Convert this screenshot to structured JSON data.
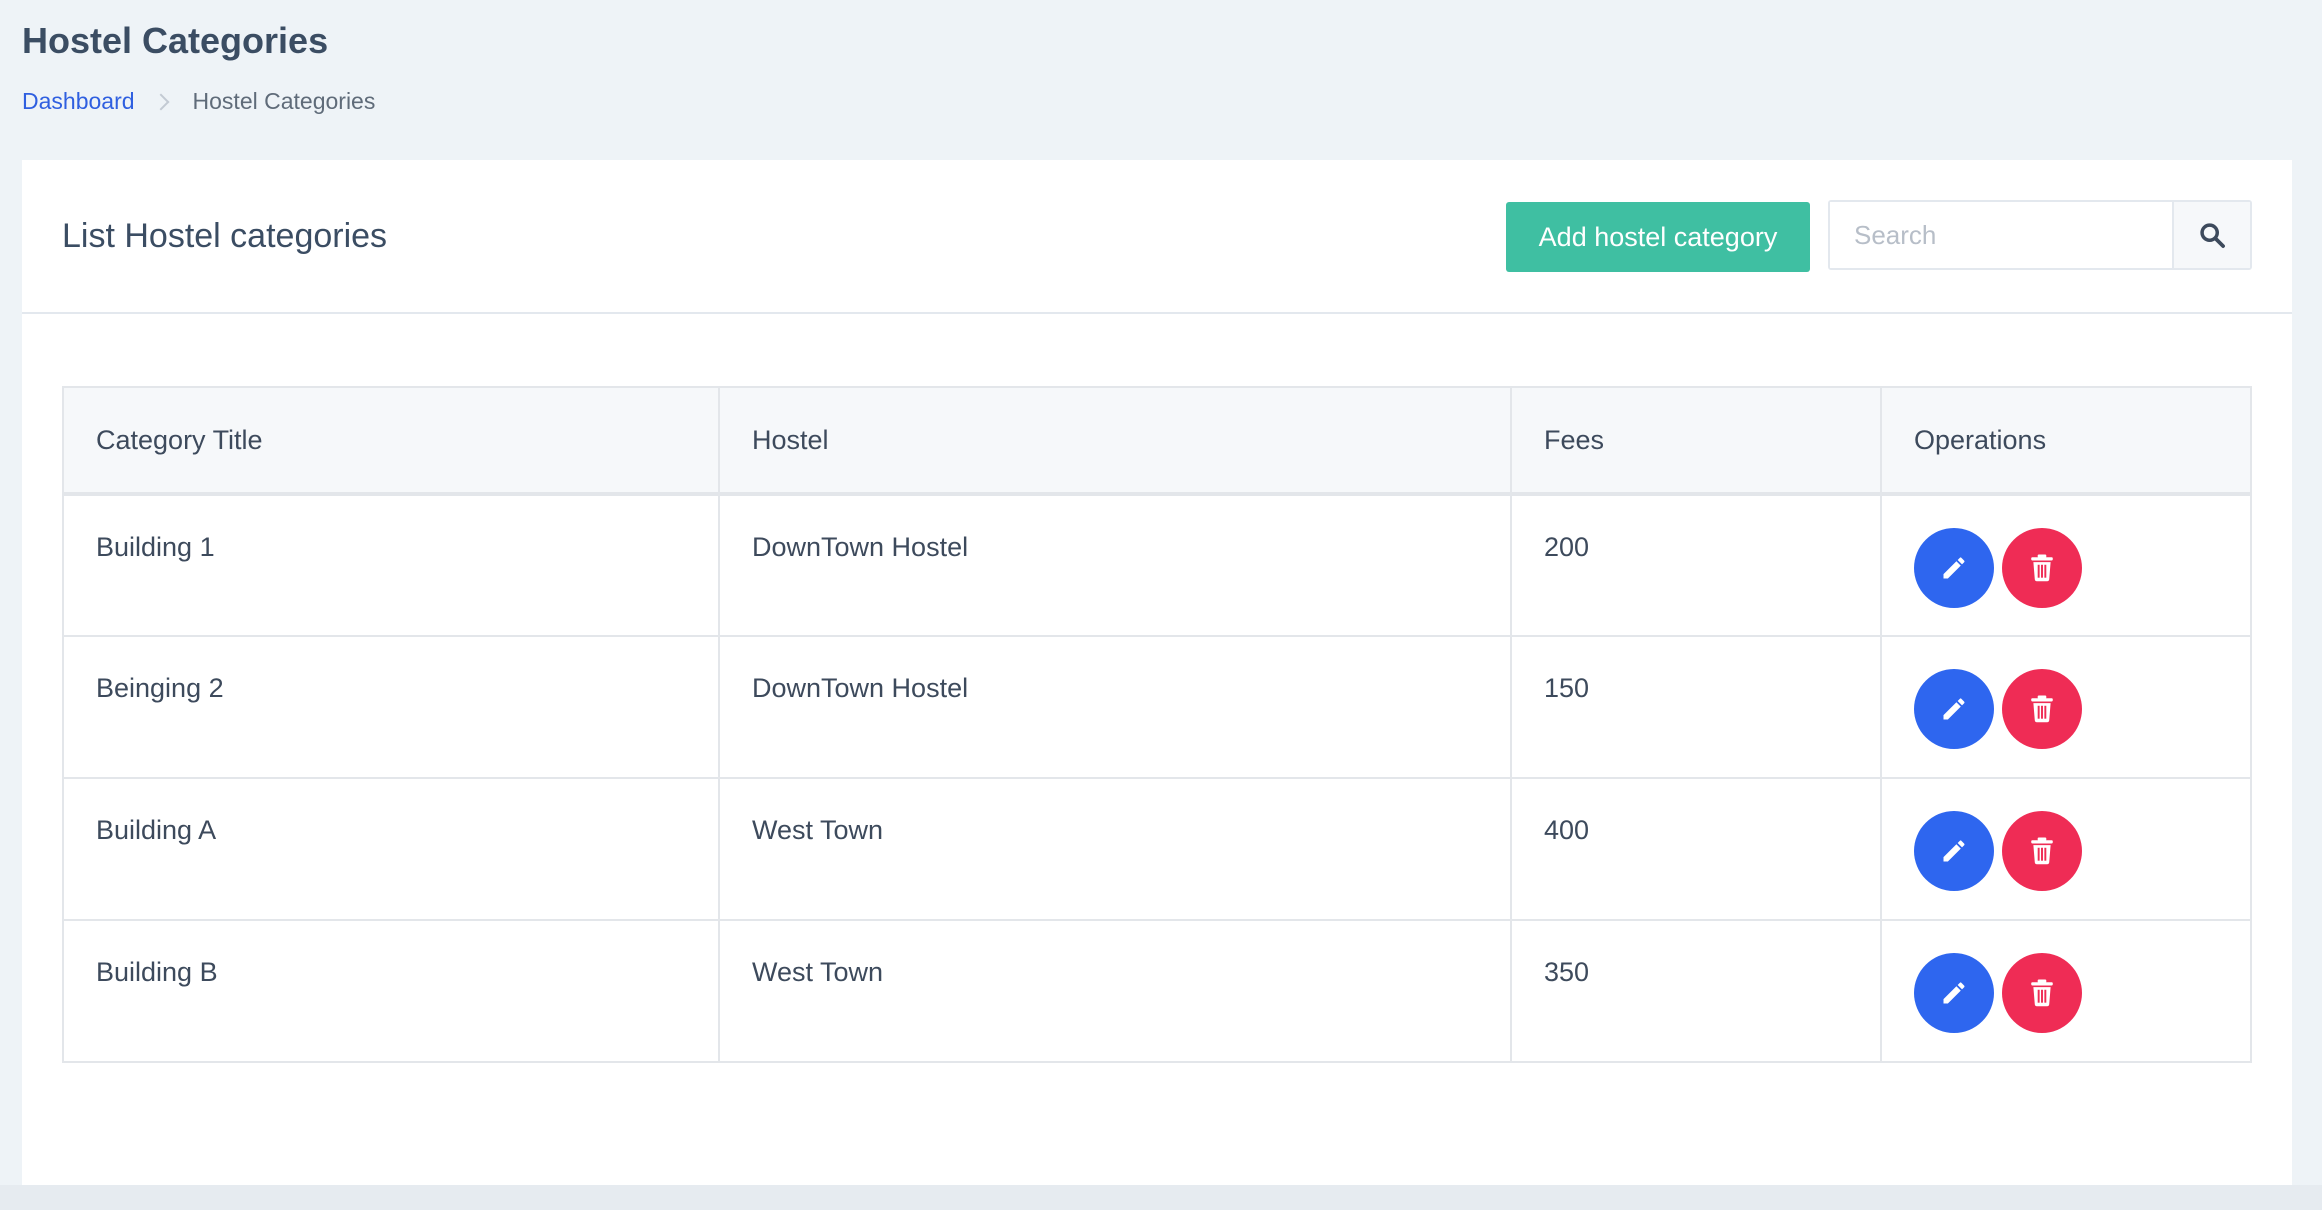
{
  "page": {
    "title": "Hostel Categories"
  },
  "breadcrumb": {
    "home": "Dashboard",
    "current": "Hostel Categories"
  },
  "card": {
    "title": "List Hostel categories",
    "add_button_label": "Add hostel category",
    "search_placeholder": "Search",
    "search_value": ""
  },
  "table": {
    "headers": [
      "Category Title",
      "Hostel",
      "Fees",
      "Operations"
    ],
    "rows": [
      {
        "title": "Building 1",
        "hostel": "DownTown Hostel",
        "fees": "200"
      },
      {
        "title": "Beinging 2",
        "hostel": "DownTown Hostel",
        "fees": "150"
      },
      {
        "title": "Building A",
        "hostel": "West Town",
        "fees": "400"
      },
      {
        "title": "Building B",
        "hostel": "West Town",
        "fees": "350"
      }
    ]
  },
  "icons": {
    "edit": "pencil-icon",
    "delete": "trash-icon",
    "search": "search-icon",
    "breadcrumb_separator": "chevron-right-icon"
  },
  "colors": {
    "primary_link": "#2f5fe0",
    "add_button": "#3fbfa2",
    "edit_button": "#2e66ef",
    "delete_button": "#ef2c55",
    "page_background": "#eef3f7"
  }
}
